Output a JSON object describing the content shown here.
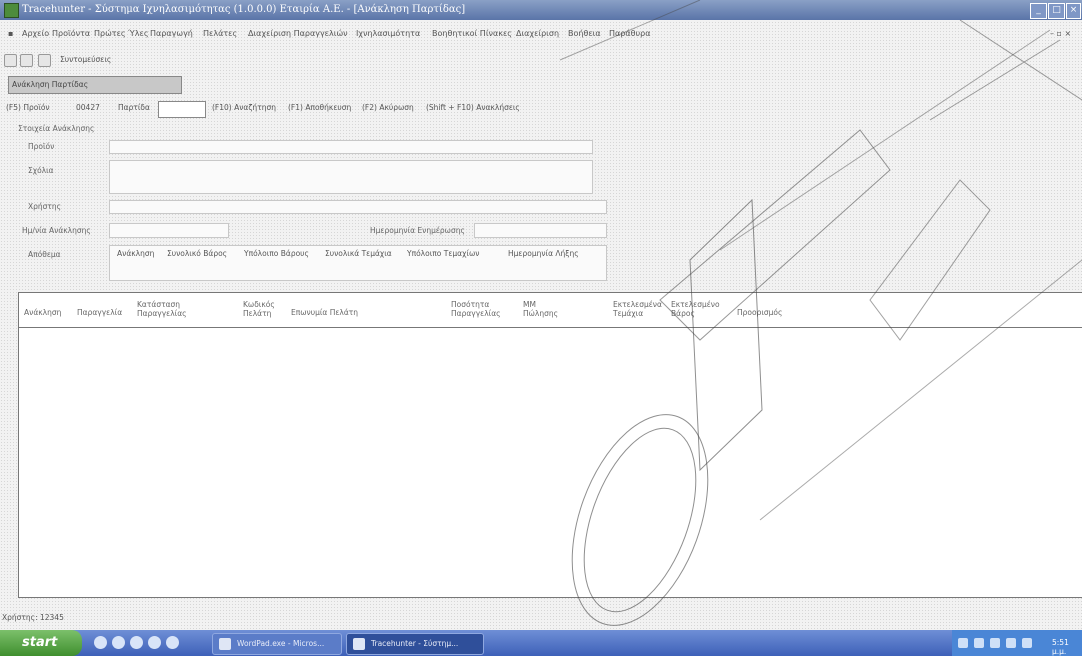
{
  "window": {
    "title": "Tracehunter - Σύστημα Ιχνηλασιμότητας (1.0.0.0) Εταιρία Α.Ε. - [Ανάκληση Παρτίδας]"
  },
  "menu": [
    "Αρχείο",
    "Προϊόντα",
    "Πρώτες Ύλες",
    "Παραγωγή",
    "Πελάτες",
    "Διαχείριση Παραγγελιών",
    "Ιχνηλασιμότητα",
    "Βοηθητικοί Πίνακες",
    "Διαχείριση",
    "Βοήθεια",
    "Παράθυρα"
  ],
  "toolbar": {
    "shortcuts_label": "Συντομεύσεις"
  },
  "form_tab": {
    "label": "Ανάκληση Παρτίδας"
  },
  "actions": {
    "product_label": "(F5) Προϊόν",
    "product_code": "00427",
    "lot_label": "Παρτίδα",
    "lot_value": "",
    "search": "(F10) Αναζήτηση",
    "save": "(F1) Αποθήκευση",
    "cancel": "(F2) Ακύρωση",
    "recall": "(Shift + F10) Ανακλήσεις"
  },
  "details": {
    "group_label": "Στοιχεία Ανάκλησης",
    "product_label": "Προϊόν",
    "comments_label": "Σχόλια",
    "user_label": "Χρήστης",
    "recall_date_label": "Ημ/νία Ανάκλησης",
    "update_date_label": "Ημερομηνία Ενημέρωσης",
    "storage_label": "Απόθεμα",
    "storage_columns": [
      "Ανάκληση",
      "Συνολικό Βάρος",
      "Υπόλοιπο Βάρους",
      "Συνολικά Τεμάχια",
      "Υπόλοιπο Τεμαχίων",
      "Ημερομηνία Λήξης"
    ]
  },
  "grid": {
    "columns": [
      "Ανάκληση",
      "Παραγγελία",
      "Κατάσταση Παραγγελίας",
      "Κωδικός Πελάτη",
      "Επωνυμία Πελάτη",
      "Ποσότητα Παραγγελίας",
      "ΜΜ Πώλησης",
      "Εκτελεσμένα Τεμάχια",
      "Εκτελεσμένο Βάρος",
      "Προορισμός"
    ]
  },
  "status": {
    "user": "Χρήστης: 12345"
  },
  "taskbar": {
    "start": "start",
    "tasks": [
      "WordPad.exe - Micros...",
      "Tracehunter - Σύστημ..."
    ],
    "clock": "5:51 μ.μ."
  },
  "colors": {
    "titlebar": "#5a74a8",
    "taskbar": "#3d60b8",
    "start": "#3f8f2e"
  }
}
